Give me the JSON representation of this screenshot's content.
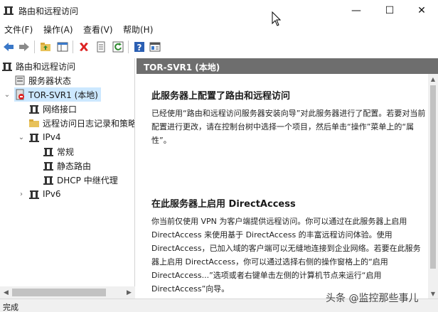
{
  "window": {
    "title": "路由和远程访问",
    "controls": {
      "minimize": "—",
      "maximize": "☐",
      "close": "✕"
    }
  },
  "menu": [
    "文件(F)",
    "操作(A)",
    "查看(V)",
    "帮助(H)"
  ],
  "toolbar": {
    "icons": [
      "back-arrow-icon",
      "forward-arrow-icon",
      "folder-up-icon",
      "show-hide-tree-icon",
      "delete-icon",
      "properties-icon",
      "refresh-icon",
      "help-icon",
      "console-icon"
    ]
  },
  "tree": {
    "root": "路由和远程访问",
    "server_status": "服务器状态",
    "server": "TOR-SVR1 (本地)",
    "network_interfaces": "网络接口",
    "remote_access_logging": "远程访问日志记录和策略",
    "ipv4": "IPv4",
    "ipv4_general": "常规",
    "ipv4_static_routes": "静态路由",
    "ipv4_dhcp_relay": "DHCP 中继代理",
    "ipv6": "IPv6"
  },
  "pane": {
    "header": "TOR-SVR1 (本地)",
    "section1_title": "此服务器上配置了路由和远程访问",
    "section1_body": "已经使用“路由和远程访问服务器安装向导”对此服务器进行了配置。若要对当前配置进行更改，请在控制台树中选择一个项目，然后单击“操作”菜单上的“属性”。",
    "section2_title": "在此服务器上启用 DirectAccess",
    "section2_body": "你当前仅使用 VPN 为客户端提供远程访问。你可以通过在此服务器上启用 DirectAccess 来使用基于 DirectAccess 的丰富远程访问体验。使用 DirectAccess，已加入域的客户端可以无缝地连接到企业网络。若要在此服务器上启用 DirectAccess，你可以通过选择右侧的操作窗格上的“启用 DirectAccess...”选项或者右键单击左侧的计算机节点来运行“启用 DirectAccess”向导。"
  },
  "status": {
    "text": "完成"
  },
  "watermark": "头条 @监控那些事儿",
  "colors": {
    "pane_header_bg": "#6e6e6e",
    "selected_bg": "#cce8ff"
  }
}
